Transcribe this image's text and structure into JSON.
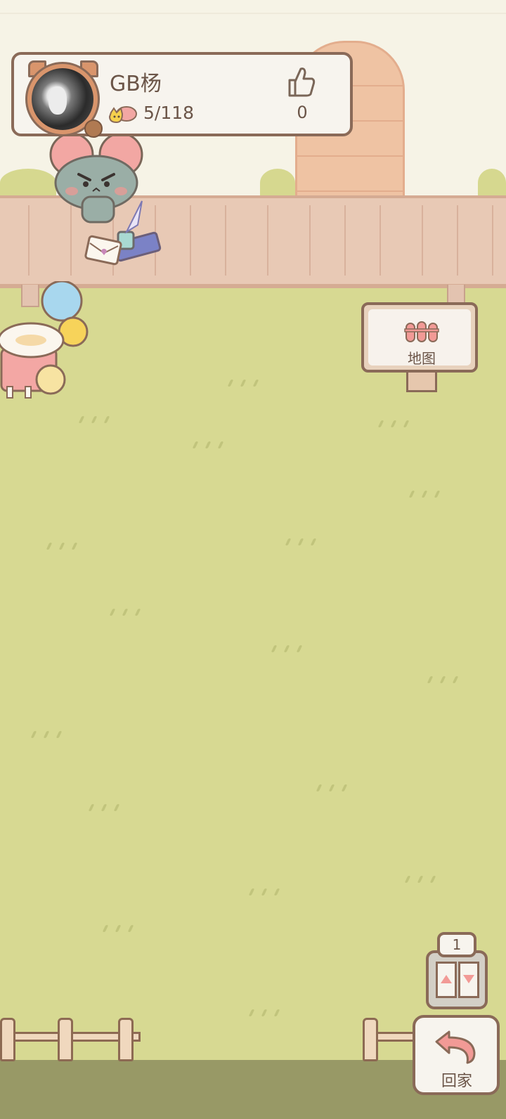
{
  "profile": {
    "username": "GB杨",
    "collection_count": "5/118",
    "likes": "0",
    "avatar_icon": "avatar-photo",
    "collection_icon": "mouse-cat-icon",
    "like_icon": "thumbs-up-icon"
  },
  "map_sign": {
    "label": "地图",
    "icon": "fence-map-icon"
  },
  "elevator": {
    "floor": "1",
    "up_icon": "up-arrow-icon",
    "down_icon": "down-arrow-icon"
  },
  "home_button": {
    "label": "回家",
    "icon": "return-arrow-icon"
  },
  "colors": {
    "grass": "#d7d992",
    "sky": "#f6f3e6",
    "fence": "#e8c9b5",
    "border_brown": "#8a6a58",
    "accent_pink": "#f29a96"
  }
}
